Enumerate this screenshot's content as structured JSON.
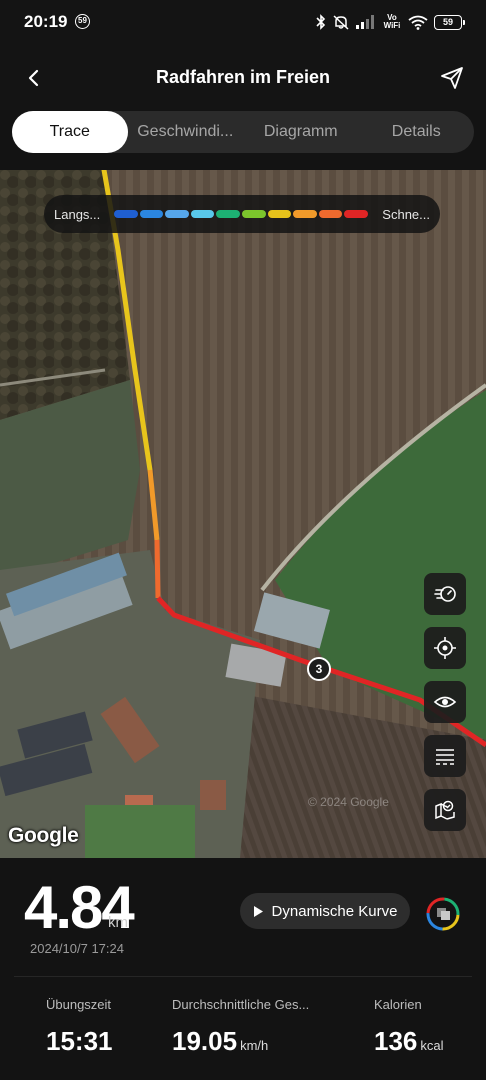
{
  "status": {
    "time": "20:19",
    "badge": "59",
    "vowifi_top": "Vo",
    "vowifi_bottom": "WiFi",
    "battery": "59"
  },
  "header": {
    "title": "Radfahren im Freien",
    "back_icon": "back-arrow-icon",
    "share_icon": "share-icon"
  },
  "tabs": [
    {
      "label": "Trace",
      "active": true
    },
    {
      "label": "Geschwindi...",
      "active": false
    },
    {
      "label": "Diagramm",
      "active": false
    },
    {
      "label": "Details",
      "active": false
    }
  ],
  "map": {
    "legend": {
      "slow_label": "Langs...",
      "fast_label": "Schne...",
      "colors": [
        "#1f5fd1",
        "#2b86e0",
        "#56a6ea",
        "#59c8ea",
        "#1db173",
        "#7cc52c",
        "#e6c21b",
        "#f19a2a",
        "#ef6a2e",
        "#e02525"
      ]
    },
    "km_marker": "3",
    "google_label": "Google",
    "copyright": "© 2024 Google",
    "tools": [
      "speedometer-icon",
      "locate-icon",
      "eye-icon",
      "layers-icon",
      "map-settings-icon"
    ]
  },
  "summary": {
    "distance": "4.84",
    "distance_unit": "km",
    "date": "2024/10/7 17:24",
    "dynamic_button": "Dynamische Kurve"
  },
  "metrics": [
    {
      "label": "Übungszeit",
      "value": "15:31",
      "unit": ""
    },
    {
      "label": "Durchschnittliche Ges...",
      "value": "19.05",
      "unit": "km/h"
    },
    {
      "label": "Kalorien",
      "value": "136",
      "unit": "kcal"
    }
  ]
}
